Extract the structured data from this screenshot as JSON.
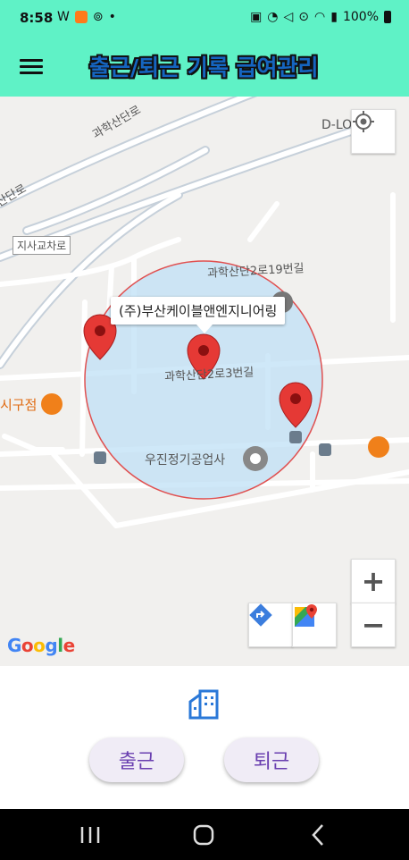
{
  "status": {
    "time": "8:58",
    "battery": "100%"
  },
  "app": {
    "title": "출근/퇴근 기록 급여관리"
  },
  "map": {
    "marker_label": "(주)부산케이블앤엔지니어링",
    "labels": {
      "road1": "과학산단로",
      "road2": "산단로",
      "junction": "지사교차로",
      "place_dlok": "D-LOK",
      "street19": "과학산단2로19번길",
      "street3": "과학산단2로3번길",
      "restaurant": "시구점",
      "company": "우진정기공업사"
    },
    "google": "Google",
    "zoom_in": "+",
    "zoom_out": "−"
  },
  "actions": {
    "clock_in": "출근",
    "clock_out": "퇴근"
  }
}
